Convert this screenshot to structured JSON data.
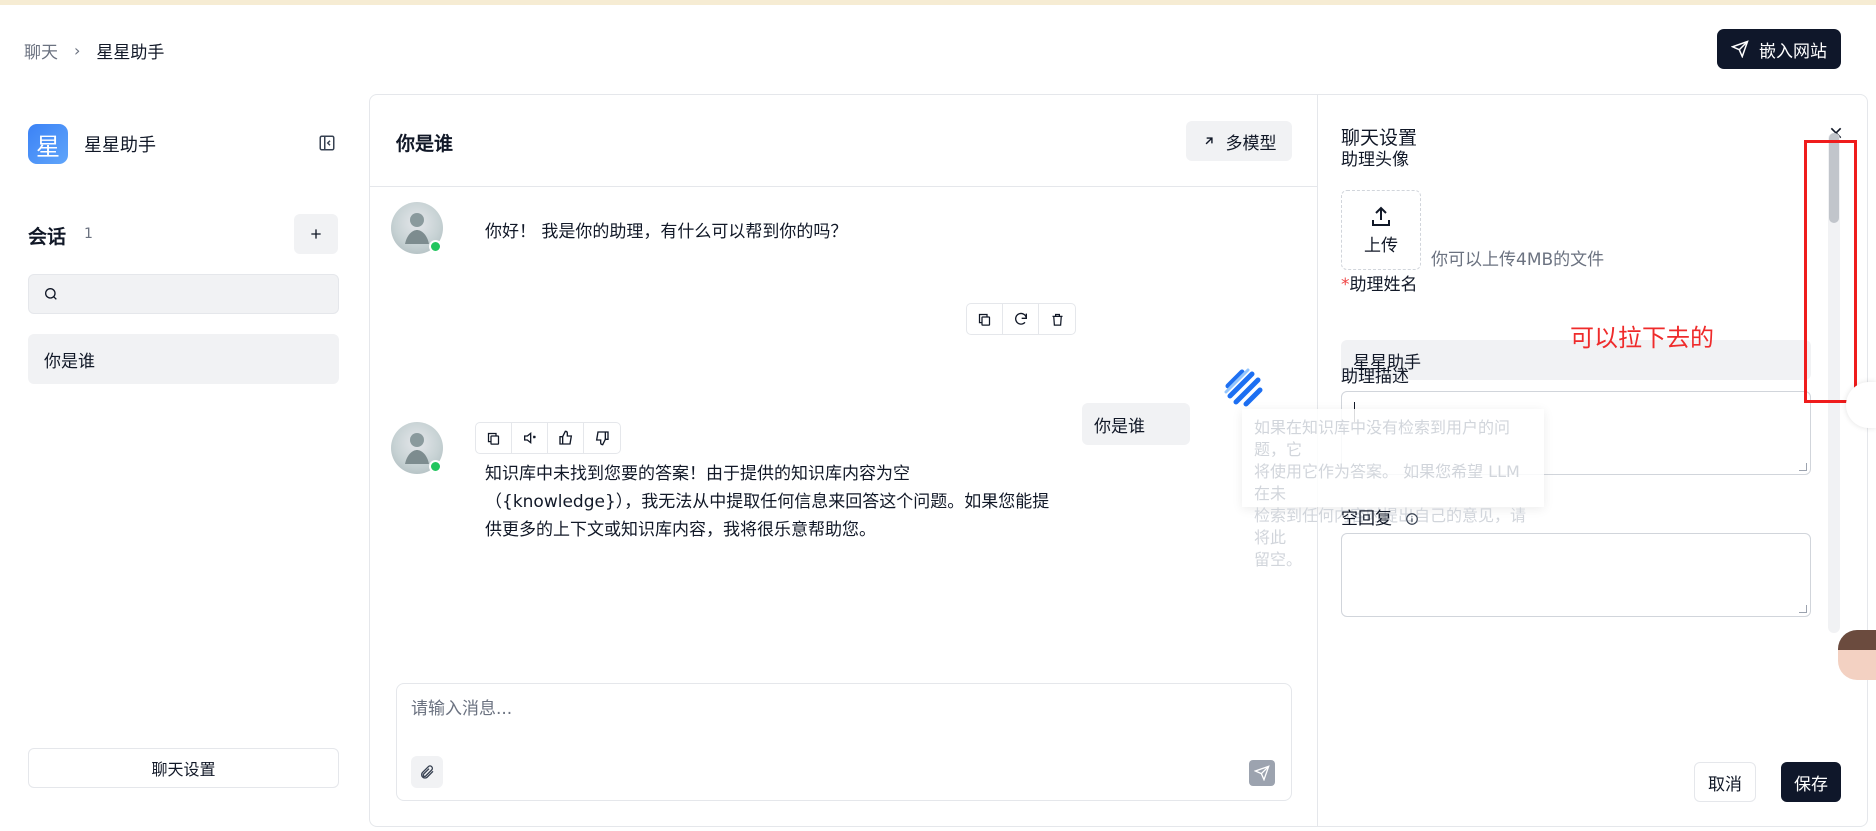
{
  "breadcrumb": {
    "root": "聊天",
    "current": "星星助手"
  },
  "header": {
    "embed_label": "嵌入网站"
  },
  "sidebar": {
    "avatar_char": "星",
    "assistant_name": "星星助手",
    "session_title": "会话",
    "session_count": "1",
    "search_placeholder": "",
    "sessions": [
      {
        "label": "你是谁"
      }
    ],
    "settings_button": "聊天设置"
  },
  "chat": {
    "title": "你是谁",
    "multi_model_label": "多模型",
    "messages": [
      {
        "role": "assistant",
        "text": "你好！ 我是你的助理，有什么可以帮到你的吗？"
      },
      {
        "role": "user",
        "text": "你是谁"
      },
      {
        "role": "assistant",
        "lines": [
          "知识库中未找到您要的答案！由于提供的知识库内容为空",
          "（{knowledge}），我无法从中提取任何信息来回答这个问题。如果您能提",
          "供更多的上下文或知识库内容，我将很乐意帮助您。"
        ]
      }
    ],
    "input_placeholder": "请输入消息..."
  },
  "settings": {
    "title": "聊天设置",
    "avatar_label": "助理头像",
    "upload_label": "上传",
    "upload_hint": "你可以上传4MB的文件",
    "name_required_mark": "*",
    "name_label": "助理姓名",
    "name_value": "星星助手",
    "desc_label": "助理描述",
    "desc_value": "",
    "tooltip_lines": [
      "如果在知识库中没有检索到用户的问题，它",
      "将使用它作为答案。 如果您希望 LLM 在未",
      "检索到任何内容时提出自己的意见，请将此",
      "留空。"
    ],
    "empty_reply_label": "空回复",
    "empty_reply_value": "",
    "cancel_label": "取消",
    "save_label": "保存"
  },
  "annotation": {
    "note": "可以拉下去的",
    "color": "#ef2b2b"
  },
  "colors": {
    "primary_dark": "#0f172a",
    "online": "#22c55e",
    "required": "#ef4444"
  }
}
